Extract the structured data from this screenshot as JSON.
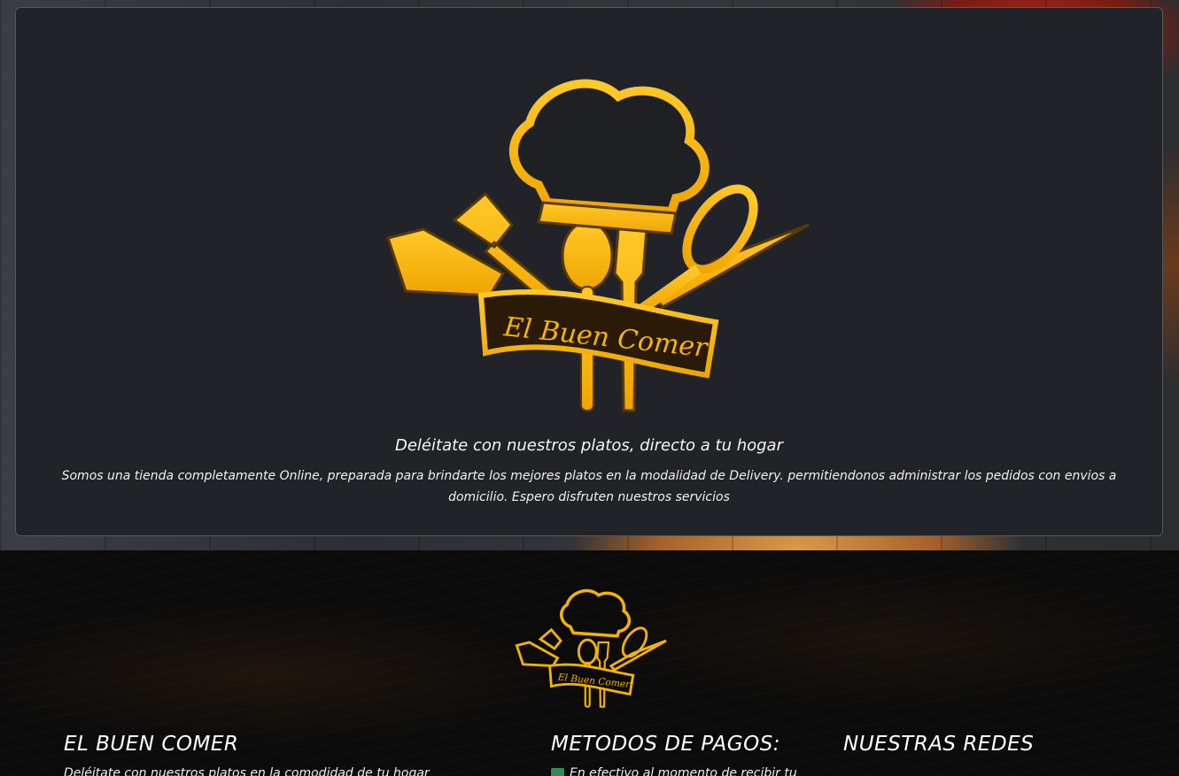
{
  "hero": {
    "logo_text": "El Buen Comer",
    "title": "Deléitate con nuestros platos, directo a tu hogar",
    "description": "Somos una tienda completamente Online, preparada para brindarte los mejores platos en la modalidad de Delivery. permitiendonos administrar los pedidos con envios a domicilio. Espero disfruten nuestros servicios"
  },
  "footer": {
    "logo_text": "El Buen Comer",
    "about": {
      "title": "EL BUEN COMER",
      "text": "Deléitate con nuestros platos en la comodidad de tu hogar"
    },
    "payments": {
      "title": "METODOS DE PAGOS:",
      "item": "En efectivo al momento de recibir tu",
      "icon": "cash-icon"
    },
    "social": {
      "title": "NUESTRAS REDES"
    }
  },
  "colors": {
    "gold": "#f5b301",
    "card_bg": "#212328",
    "footer_bg": "#0b0b0b"
  }
}
